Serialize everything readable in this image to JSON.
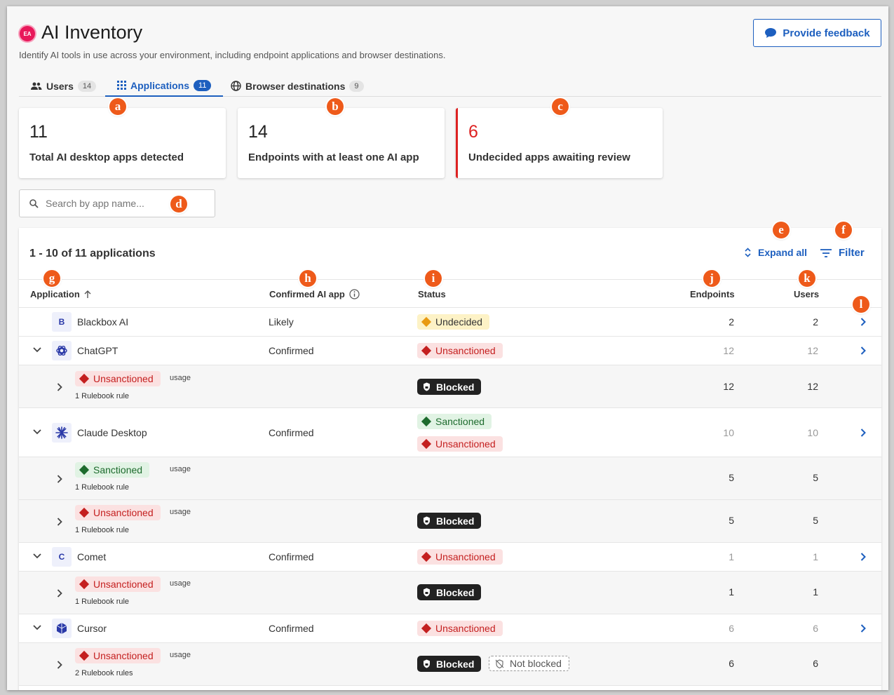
{
  "header": {
    "logo_text": "EA",
    "title": "AI Inventory",
    "subtitle": "Identify AI tools in use across your environment, including endpoint applications and browser destinations.",
    "feedback_label": "Provide feedback"
  },
  "tabs": [
    {
      "label": "Users",
      "count": "14",
      "icon": "users-icon"
    },
    {
      "label": "Applications",
      "count": "11",
      "icon": "grid-icon",
      "active": true
    },
    {
      "label": "Browser destinations",
      "count": "9",
      "icon": "globe-icon"
    }
  ],
  "markers": [
    "a",
    "b",
    "c",
    "d",
    "e",
    "f",
    "g",
    "h",
    "i",
    "j",
    "k",
    "l"
  ],
  "stats": [
    {
      "value": "11",
      "label": "Total AI desktop apps detected"
    },
    {
      "value": "14",
      "label": "Endpoints with at least one AI app"
    },
    {
      "value": "6",
      "label": "Undecided apps awaiting review"
    }
  ],
  "search": {
    "placeholder": "Search by app name..."
  },
  "table": {
    "count_text": "1 - 10 of 11 applications",
    "expand_all_label": "Expand all",
    "filter_label": "Filter",
    "columns": {
      "application": "Application",
      "confirmed": "Confirmed AI app",
      "status": "Status",
      "endpoints": "Endpoints",
      "users": "Users"
    },
    "rows": [
      {
        "icon": "B",
        "name": "Blackbox AI",
        "confirmed": "Likely",
        "status": "Undecided",
        "endpoints": "2",
        "users": "2"
      },
      {
        "icon": "chatgpt-logo",
        "name": "ChatGPT",
        "confirmed": "Confirmed",
        "status": "Unsanctioned",
        "endpoints": "12",
        "users": "12"
      },
      {
        "pill": "Unsanctioned",
        "usage": "usage",
        "rule": "1 Rulebook rule",
        "status": "Blocked",
        "endpoints": "12",
        "users": "12"
      },
      {
        "icon": "claude-logo",
        "name": "Claude Desktop",
        "confirmed": "Confirmed",
        "status": "Sanctioned",
        "status2": "Unsanctioned",
        "endpoints": "10",
        "users": "10"
      },
      {
        "pill": "Sanctioned",
        "usage": "usage",
        "rule": "1 Rulebook rule",
        "endpoints": "5",
        "users": "5"
      },
      {
        "pill": "Unsanctioned",
        "usage": "usage",
        "rule": "1 Rulebook rule",
        "status": "Blocked",
        "endpoints": "5",
        "users": "5"
      },
      {
        "icon": "C",
        "name": "Comet",
        "confirmed": "Confirmed",
        "status": "Unsanctioned",
        "endpoints": "1",
        "users": "1"
      },
      {
        "pill": "Unsanctioned",
        "usage": "usage",
        "rule": "1 Rulebook rule",
        "status": "Blocked",
        "endpoints": "1",
        "users": "1"
      },
      {
        "icon": "cursor-logo",
        "name": "Cursor",
        "confirmed": "Confirmed",
        "status": "Unsanctioned",
        "endpoints": "6",
        "users": "6"
      },
      {
        "pill": "Unsanctioned",
        "usage": "usage",
        "rule": "2 Rulebook rules",
        "status": "Blocked",
        "status2": "Not blocked",
        "endpoints": "6",
        "users": "6"
      }
    ]
  },
  "colors": {
    "accent": "#1d5fbf",
    "unsanctioned": "#c41f1f",
    "sanctioned": "#1d6b2d",
    "undecided": "#e89a12",
    "marker": "#ee5a1a",
    "logo": "#e8185a"
  }
}
